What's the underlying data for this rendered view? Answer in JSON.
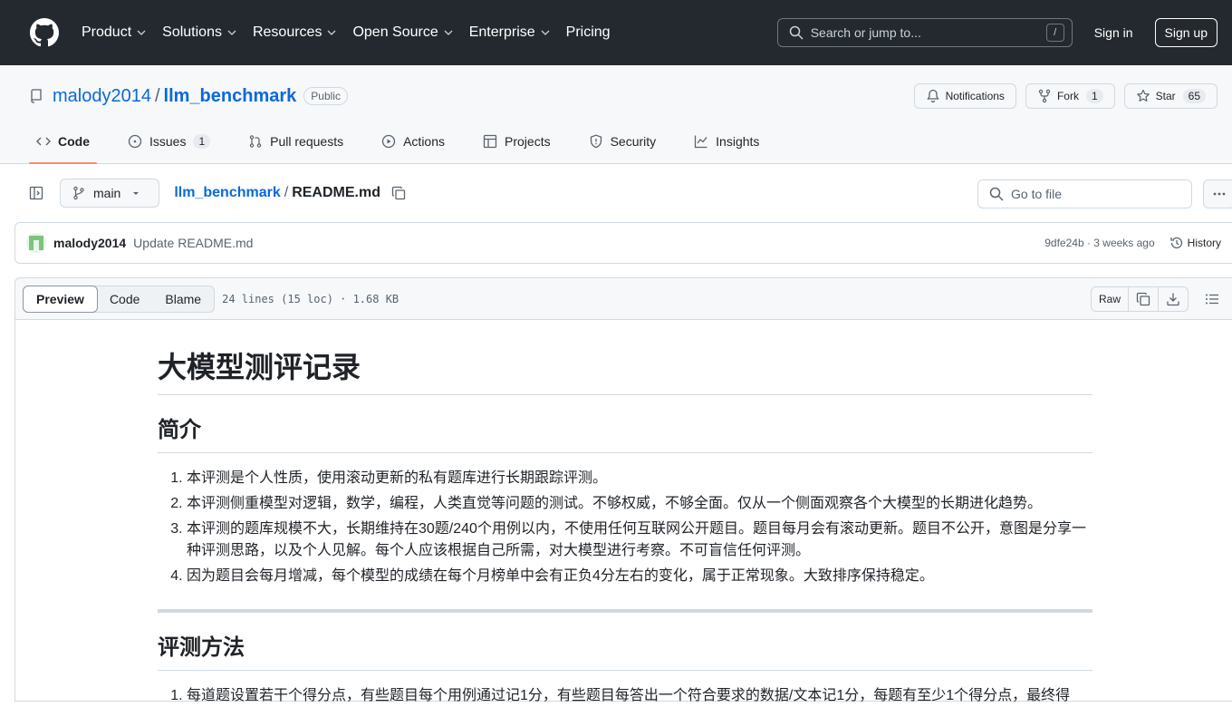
{
  "header": {
    "nav": [
      "Product",
      "Solutions",
      "Resources",
      "Open Source",
      "Enterprise",
      "Pricing"
    ],
    "search_placeholder": "Search or jump to...",
    "search_key": "/",
    "sign_in": "Sign in",
    "sign_up": "Sign up"
  },
  "repo": {
    "owner": "malody2014",
    "separator": "/",
    "name": "llm_benchmark",
    "visibility": "Public",
    "notifications": "Notifications",
    "fork": "Fork",
    "fork_count": "1",
    "star": "Star",
    "star_count": "65"
  },
  "tabs": [
    {
      "label": "Code",
      "icon": "code-icon"
    },
    {
      "label": "Issues",
      "icon": "issue-icon",
      "count": "1"
    },
    {
      "label": "Pull requests",
      "icon": "pull-request-icon"
    },
    {
      "label": "Actions",
      "icon": "play-icon"
    },
    {
      "label": "Projects",
      "icon": "table-icon"
    },
    {
      "label": "Security",
      "icon": "shield-icon"
    },
    {
      "label": "Insights",
      "icon": "graph-icon"
    }
  ],
  "filenav": {
    "branch": "main",
    "root": "llm_benchmark",
    "separator": "/",
    "file": "README.md",
    "goto_placeholder": "Go to file"
  },
  "commit": {
    "author": "malody2014",
    "message": "Update README.md",
    "meta": "9dfe24b · 3 weeks ago",
    "history": "History"
  },
  "viewer": {
    "modes": [
      "Preview",
      "Code",
      "Blame"
    ],
    "info": "24 lines (15 loc) · 1.68 KB",
    "raw": "Raw"
  },
  "readme": {
    "title": "大模型测评记录",
    "intro_heading": "简介",
    "intro_items": [
      "本评测是个人性质，使用滚动更新的私有题库进行长期跟踪评测。",
      "本评测侧重模型对逻辑，数学，编程，人类直觉等问题的测试。不够权威，不够全面。仅从一个侧面观察各个大模型的长期进化趋势。",
      "本评测的题库规模不大，长期维持在30题/240个用例以内，不使用任何互联网公开题目。题目每月会有滚动更新。题目不公开，意图是分享一种评测思路，以及个人见解。每个人应该根据自己所需，对大模型进行考察。不可盲信任何评测。",
      "因为题目会每月增减，每个模型的成绩在每个月榜单中会有正负4分左右的变化，属于正常现象。大致排序保持稳定。"
    ],
    "method_heading": "评测方法",
    "method_items": [
      "每道题设置若干个得分点，有些题目每个用例通过记1分，有些题目每答出一个符合要求的数据/文本记1分，每题有至少1个得分点，最终得"
    ]
  }
}
